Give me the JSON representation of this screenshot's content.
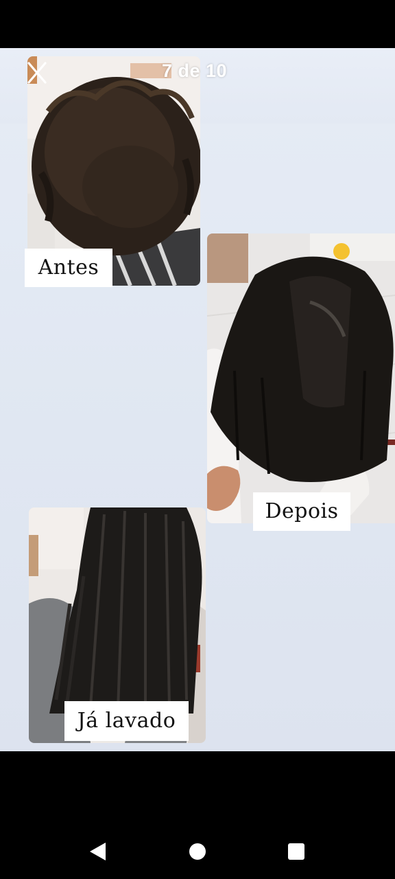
{
  "viewer": {
    "counter": "7 de 10"
  },
  "photos": {
    "before_caption": "Antes",
    "after_caption": "Depois",
    "washed_caption": "Já lavado"
  },
  "nav": {
    "back_icon": "back-triangle-icon",
    "home_icon": "home-circle-icon",
    "recents_icon": "recents-square-icon"
  }
}
